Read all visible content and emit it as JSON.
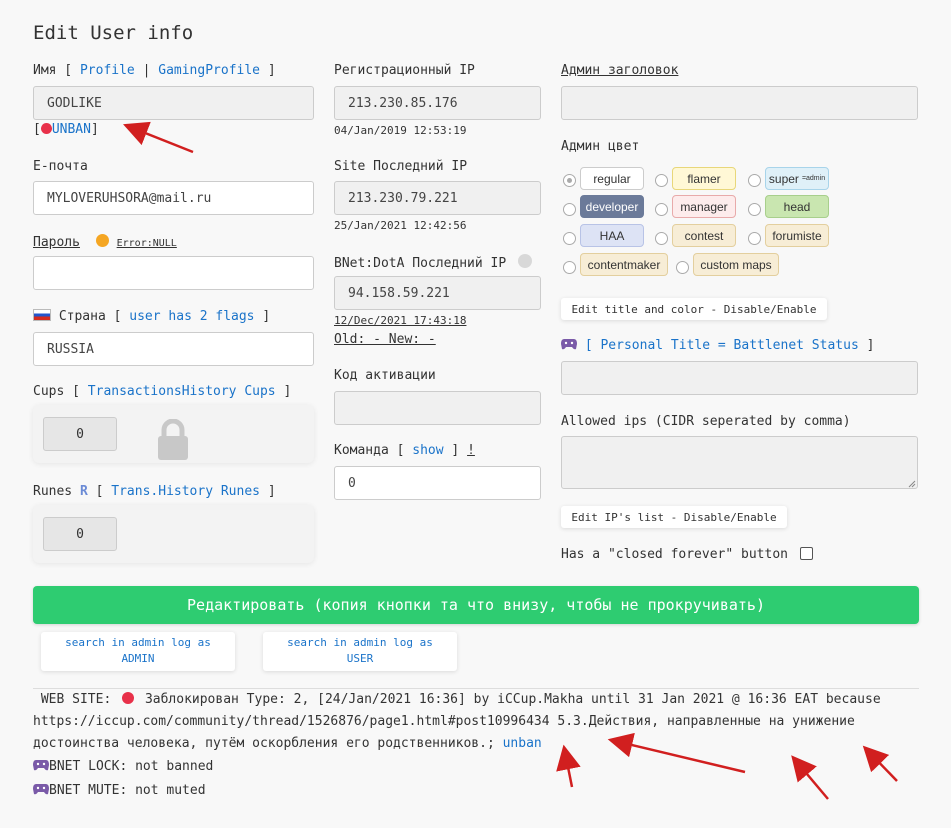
{
  "page_title": "Edit User info",
  "left": {
    "name_label": "Имя",
    "profile_link": "Profile",
    "sep": "|",
    "gaming_profile_link": "GamingProfile",
    "name_value": "GODLIKE",
    "unban_link": "UNBAN",
    "email_label": "E-почта",
    "email_value": "MYLOVERUHSORA@mail.ru",
    "password_label": "Пароль",
    "password_error": "Error:NULL",
    "password_value": "",
    "country_label": "Страна",
    "flags_link": "user has 2 flags",
    "country_value": "RUSSIA",
    "cups_label": "Cups",
    "cups_link": "TransactionsHistory Cups",
    "cups_value": "0",
    "runes_label": "Runes",
    "runes_icon": "R",
    "runes_link": "Trans.History Runes",
    "runes_value": "0"
  },
  "middle": {
    "reg_ip_label": "Регистрационный IP",
    "reg_ip_value": "213.230.85.176",
    "reg_ip_date": "04/Jan/2019 12:53:19",
    "site_ip_label": "Site Последний IP",
    "site_ip_value": "213.230.79.221",
    "site_ip_date": "25/Jan/2021 12:42:56",
    "bnet_ip_label": "BNet:DotA Последний IP",
    "bnet_ip_value": "94.158.59.221",
    "bnet_ip_date": "12/Dec/2021 17:43:18",
    "old_new": "Old: - New: -",
    "activation_label": "Код активации",
    "activation_value": "",
    "team_label": "Команда",
    "team_show_link": "show",
    "team_excl": "!",
    "team_value": "0"
  },
  "right": {
    "admin_title_label": "Админ заголовок",
    "admin_title_value": "",
    "admin_color_label": "Админ цвет",
    "colors": [
      {
        "label": "regular",
        "suffix": "",
        "checked": true,
        "bg": "#ffffff",
        "border": "#cccccc",
        "fg": "#333333"
      },
      {
        "label": "flamer",
        "suffix": "",
        "checked": false,
        "bg": "#fff8d6",
        "border": "#e8d77a",
        "fg": "#333333"
      },
      {
        "label": "super",
        "suffix": "=admin",
        "checked": false,
        "bg": "#dff0f8",
        "border": "#a8d4ea",
        "fg": "#333333"
      },
      {
        "label": "developer",
        "suffix": "",
        "checked": false,
        "bg": "#6b7a99",
        "border": "#6b7a99",
        "fg": "#ffffff"
      },
      {
        "label": "manager",
        "suffix": "",
        "checked": false,
        "bg": "#fdecec",
        "border": "#e8aaaa",
        "fg": "#333333"
      },
      {
        "label": "head",
        "suffix": "",
        "checked": false,
        "bg": "#c9e6b0",
        "border": "#a8cf8c",
        "fg": "#333333"
      },
      {
        "label": "HAA",
        "suffix": "",
        "checked": false,
        "bg": "#dde3f5",
        "border": "#b8c3e6",
        "fg": "#333333"
      },
      {
        "label": "contest",
        "suffix": "",
        "checked": false,
        "bg": "#f7edd6",
        "border": "#e3cf9e",
        "fg": "#333333"
      },
      {
        "label": "forumiste",
        "suffix": "",
        "checked": false,
        "bg": "#f7edd6",
        "border": "#e3cf9e",
        "fg": "#333333"
      },
      {
        "label": "contentmaker",
        "suffix": "",
        "checked": false,
        "bg": "#f7edd6",
        "border": "#e3cf9e",
        "fg": "#333333"
      },
      {
        "label": "custom maps",
        "suffix": "",
        "checked": false,
        "bg": "#f7edd6",
        "border": "#e3cf9e",
        "fg": "#333333"
      }
    ],
    "edit_title_button": "Edit title and color - Disable/Enable",
    "personal_title_link": "Personal Title = Battlenet Status",
    "personal_title_value": "",
    "allowed_ips_label": "Allowed ips (CIDR seperated by comma)",
    "allowed_ips_value": "",
    "edit_ips_button": "Edit IP's list - Disable/Enable",
    "closed_forever_label": "Has a \"closed forever\" button"
  },
  "actions": {
    "edit_button": "Редактировать (копия кнопки та что внизу, чтобы не прокручивать)",
    "search_admin_line1": "search in admin log as",
    "search_admin_line2": "ADMIN",
    "search_user_line1": "search in admin log as",
    "search_user_line2": "USER"
  },
  "status": {
    "website_prefix": "WEB SITE:",
    "website_text1": "Заблокирован Type: 2, [24/Jan/2021 16:36] by iCCup.Makha until 31 Jan 2021 @ 16:36 EAT because",
    "website_text2": "https://iccup.com/community/thread/1526876/page1.html#post10996434 5.3.Действия, направленные на унижение",
    "website_text3": "достоинства человека, путём оскорбления его родственников.;",
    "unban_link": "unban",
    "bnet_lock": "BNET LOCK: not banned",
    "bnet_mute": "BNET MUTE: not muted"
  },
  "colors": {
    "link": "#1a73c9",
    "green": "#2ecc71",
    "ban_red": "#e8314a",
    "arrow_red": "#d11f1f",
    "error_orange": "#f5a623"
  }
}
